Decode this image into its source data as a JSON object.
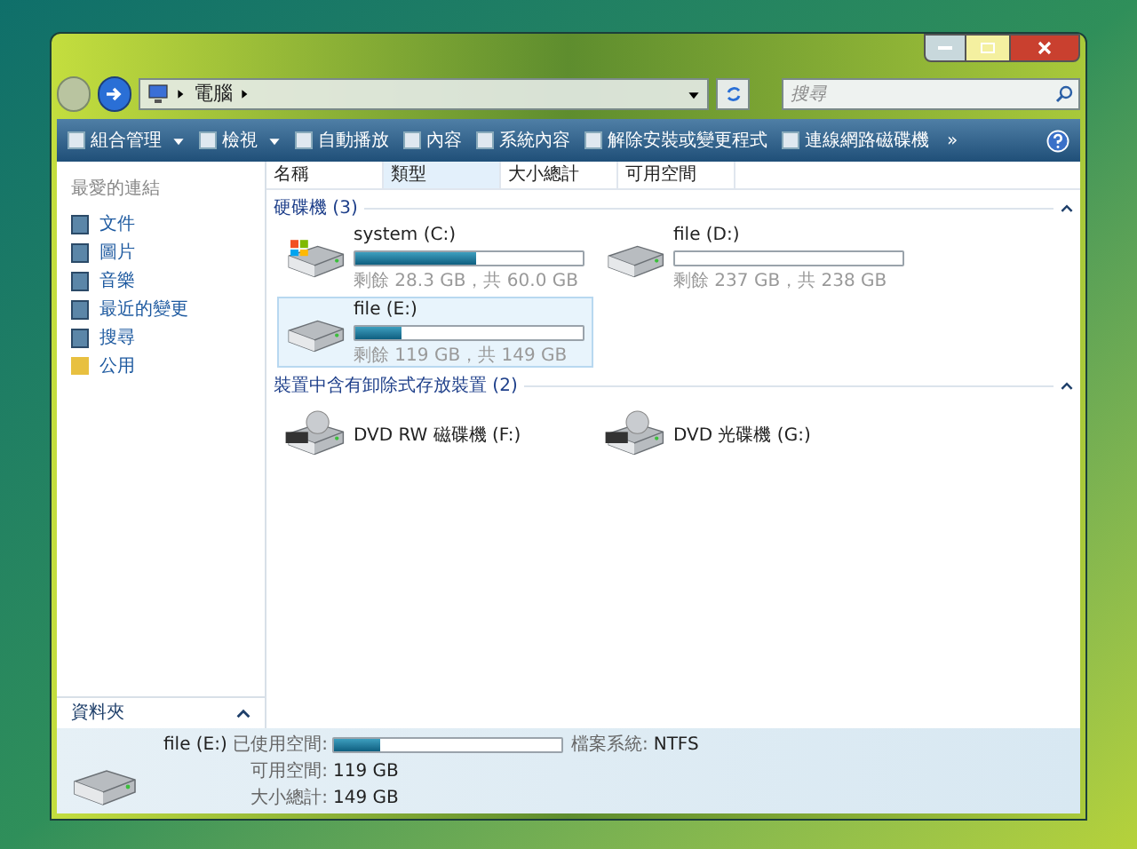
{
  "address": {
    "path": [
      "電腦"
    ]
  },
  "search": {
    "placeholder": "搜尋"
  },
  "toolbar": [
    {
      "label": "組合管理",
      "kind": "menu"
    },
    {
      "label": "檢視",
      "kind": "menu"
    },
    {
      "label": "自動播放",
      "kind": "button"
    },
    {
      "label": "內容",
      "kind": "button"
    },
    {
      "label": "系統內容",
      "kind": "button"
    },
    {
      "label": "解除安裝或變更程式",
      "kind": "button"
    },
    {
      "label": "連線網路磁碟機",
      "kind": "button"
    },
    {
      "label": "»",
      "kind": "overflow"
    }
  ],
  "sidebar": {
    "heading": "最愛的連結",
    "links": [
      {
        "label": "文件"
      },
      {
        "label": "圖片"
      },
      {
        "label": "音樂"
      },
      {
        "label": "最近的變更"
      },
      {
        "label": "搜尋"
      },
      {
        "label": "公用",
        "kind": "folder"
      }
    ],
    "folders": "資料夾"
  },
  "columns": [
    {
      "label": "名稱",
      "selected": false
    },
    {
      "label": "類型",
      "selected": true
    },
    {
      "label": "大小總計",
      "selected": false
    },
    {
      "label": "可用空間",
      "selected": false
    }
  ],
  "groups": [
    {
      "title": "硬碟機 (3)",
      "items": [
        {
          "kind": "hdd-windows",
          "name": "system (C:)",
          "level": 0.53,
          "info": "剩餘 28.3 GB，共 60.0 GB",
          "selected": false
        },
        {
          "kind": "hdd",
          "name": "file (D:)",
          "level": 0.0,
          "info": "剩餘 237 GB，共 238 GB",
          "selected": false
        },
        {
          "kind": "hdd",
          "name": "file (E:)",
          "level": 0.2,
          "info": "剩餘 119 GB，共 149 GB",
          "selected": true
        }
      ]
    },
    {
      "title": "裝置中含有卸除式存放裝置 (2)",
      "items": [
        {
          "kind": "dvd",
          "name": "DVD RW 磁碟機 (F:)"
        },
        {
          "kind": "dvd",
          "name": "DVD 光碟機 (G:)"
        }
      ]
    }
  ],
  "details": {
    "name": "file (E:)",
    "used_label": "已使用空間:",
    "level": 0.2,
    "fs_label": "檔案系統:",
    "fs": "NTFS",
    "free_label": "可用空間:",
    "free": "119 GB",
    "total_label": "大小總計:",
    "total": "149 GB"
  }
}
